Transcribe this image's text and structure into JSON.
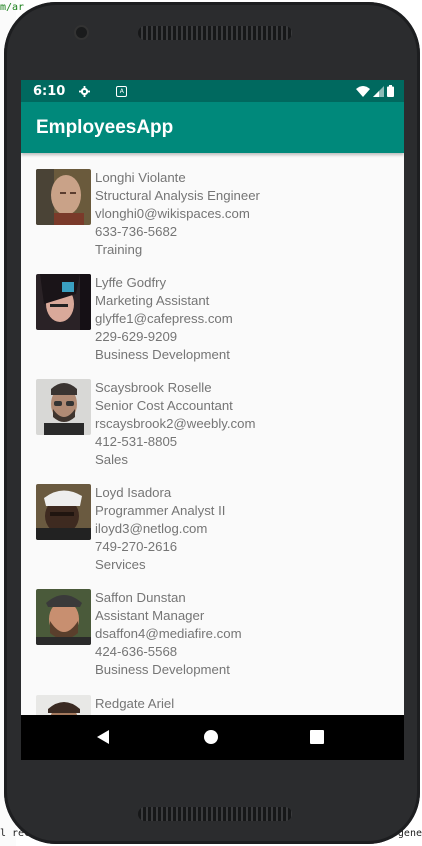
{
  "ide": {
    "line1": "m/ar",
    "bottom_text": "l rec",
    "bottom_right": ".gene"
  },
  "status": {
    "time": "6:10"
  },
  "app": {
    "title": "EmployeesApp"
  },
  "employees": [
    {
      "name": "Longhi Violante",
      "title": "Structural Analysis Engineer",
      "email": "vlonghi0@wikispaces.com",
      "phone": "633-736-5682",
      "department": "Training"
    },
    {
      "name": "Lyffe Godfry",
      "title": "Marketing Assistant",
      "email": "glyffe1@cafepress.com",
      "phone": "229-629-9209",
      "department": "Business Development"
    },
    {
      "name": "Scaysbrook Roselle",
      "title": "Senior Cost Accountant",
      "email": "rscaysbrook2@weebly.com",
      "phone": "412-531-8805",
      "department": "Sales"
    },
    {
      "name": "Loyd Isadora",
      "title": "Programmer Analyst II",
      "email": "iloyd3@netlog.com",
      "phone": "749-270-2616",
      "department": "Services"
    },
    {
      "name": "Saffon Dunstan",
      "title": "Assistant Manager",
      "email": "dsaffon4@mediafire.com",
      "phone": "424-636-5568",
      "department": "Business Development"
    },
    {
      "name": "Redgate Ariel"
    }
  ]
}
